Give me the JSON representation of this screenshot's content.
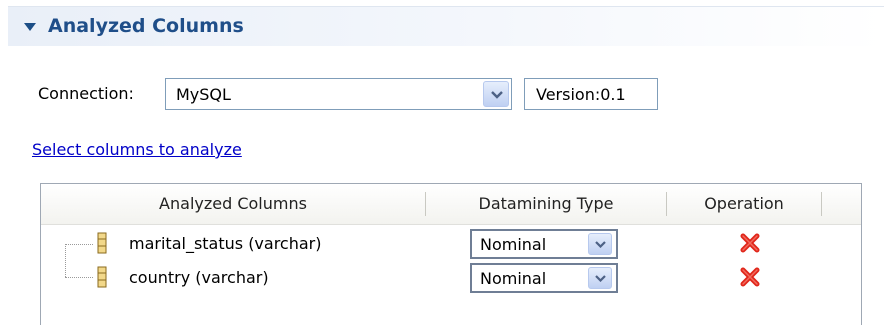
{
  "section": {
    "title": "Analyzed Columns"
  },
  "connection": {
    "label": "Connection:",
    "value": "MySQL",
    "version": "Version:0.1"
  },
  "select_link": "Select columns to analyze",
  "table": {
    "headers": [
      "Analyzed Columns",
      "Datamining Type",
      "Operation"
    ],
    "rows": [
      {
        "column": "marital_status (varchar)",
        "datamining_type": "Nominal"
      },
      {
        "column": "country (varchar)",
        "datamining_type": "Nominal"
      }
    ]
  },
  "colors": {
    "header_title": "#1f4e89",
    "link": "#0000c8",
    "delete": "#e0261a"
  },
  "icons": {
    "twisty": "triangle-down-icon",
    "dropdown": "chevron-down-icon",
    "column": "column-icon",
    "delete": "red-x-icon"
  }
}
